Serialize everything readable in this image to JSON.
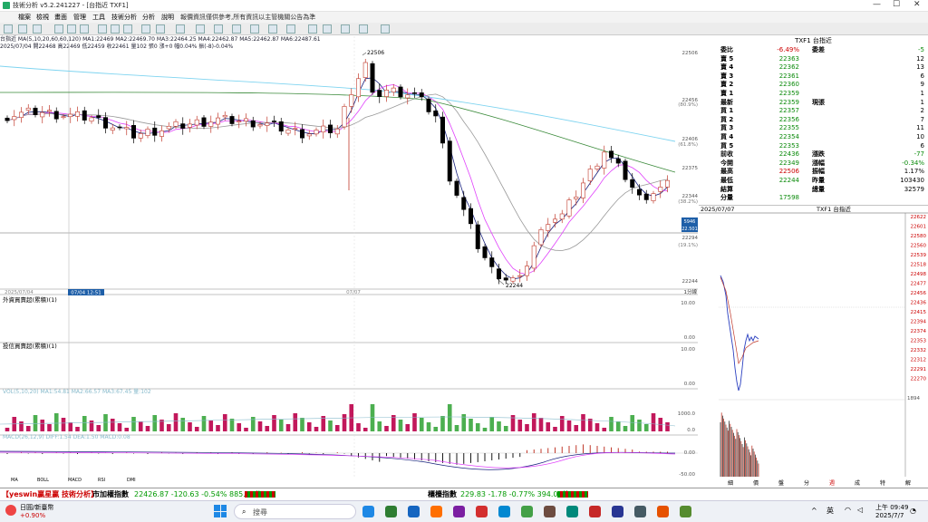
{
  "window": {
    "title": "技術分析 v5.2.241227 - [台指近 TXF1]"
  },
  "menu": [
    "檔案",
    "檢視",
    "畫面",
    "管理",
    "工具",
    "技術分析",
    "分析",
    "說明",
    "報價資訊僅供參考,所有資訊以主管機關公告為準"
  ],
  "info": {
    "line1": "台指近 MA(5,10,20,60,60,120) MA1:22469 MA2:22469.70 MA3:22464.25 MA4:22462.87 MA5:22462.87 MA6:22487.61",
    "line2": "2025/07/04 開22468 高22469 低22459 收22461 量102 張0 漲+0 幅0.04% 振(-8)-0.04%"
  },
  "price_axis": [
    "22506",
    "22456",
    "22406",
    "22375",
    "22359",
    "22344",
    "22294",
    "22244"
  ],
  "axis_pct": [
    "(80.9%)",
    "(61.8%)",
    "(38.2%)",
    "(19.1%)"
  ],
  "annotations": {
    "high": "22506",
    "low": "22244",
    "cursor_date": "07/04 12:51",
    "date2": "07/07",
    "date0": "2025/07/04",
    "vol_box": "5946",
    "price_box": "22.501"
  },
  "panels": {
    "foreign": "外資買賣超(累積)(1)",
    "dealer": "投信買賣超(累積)(1)",
    "vol": "VOL(5,10,20) MA1:54.81 MA2:66.57 MA3:67.45 量:102",
    "macd": "MACD(26,12,9) DIFF:1.54 DEA:1.50 MACD:0.08",
    "period": "1分線"
  },
  "panel_axis": {
    "foreign": [
      "10.00",
      "0.00"
    ],
    "dealer": [
      "10.00",
      "0.00"
    ],
    "vol": [
      "1000.0",
      "0.0"
    ],
    "macd": [
      "0.00",
      "-50.00"
    ]
  },
  "bottom_tabs": [
    "MA",
    "BOLL",
    "MACD",
    "RSI",
    "DMI"
  ],
  "quote": {
    "title": "TXF1 台指近",
    "rows": [
      {
        "l": "委比",
        "v": "-6.49%",
        "r": "委差",
        "rv": "-5"
      },
      {
        "l": "賣 5",
        "v": "22363",
        "r": "",
        "rv": "12"
      },
      {
        "l": "賣 4",
        "v": "22362",
        "r": "",
        "rv": "13"
      },
      {
        "l": "賣 3",
        "v": "22361",
        "r": "",
        "rv": "6"
      },
      {
        "l": "賣 2",
        "v": "22360",
        "r": "",
        "rv": "9"
      },
      {
        "l": "賣 1",
        "v": "22359",
        "r": "",
        "rv": "1"
      },
      {
        "l": "最新",
        "v": "22359",
        "r": "現張",
        "rv": "1"
      },
      {
        "l": "買 1",
        "v": "22357",
        "r": "",
        "rv": "2"
      },
      {
        "l": "買 2",
        "v": "22356",
        "r": "",
        "rv": "7"
      },
      {
        "l": "買 3",
        "v": "22355",
        "r": "",
        "rv": "11"
      },
      {
        "l": "買 4",
        "v": "22354",
        "r": "",
        "rv": "10"
      },
      {
        "l": "買 5",
        "v": "22353",
        "r": "",
        "rv": "6"
      },
      {
        "l": "前收",
        "v": "22436",
        "r": "漲跌",
        "rv": "-77"
      },
      {
        "l": "今開",
        "v": "22349",
        "r": "漲幅",
        "rv": "-0.34%"
      },
      {
        "l": "最高",
        "v": "22506",
        "r": "振幅",
        "rv": "1.17%"
      },
      {
        "l": "最低",
        "v": "22244",
        "r": "昨量",
        "rv": "103430"
      },
      {
        "l": "結算",
        "v": "",
        "r": "總量",
        "rv": "32579"
      },
      {
        "l": "分量",
        "v": "17598",
        "r": "",
        "rv": ""
      }
    ],
    "mini_title_date": "2025/07/07",
    "mini_title": "TXF1 台指近"
  },
  "mini_axis": [
    "22622",
    "22601",
    "22580",
    "22560",
    "22539",
    "22518",
    "22498",
    "22477",
    "22456",
    "22436",
    "22415",
    "22394",
    "22374",
    "22353",
    "22332",
    "22312",
    "22291",
    "22270"
  ],
  "mini_vol": "1894",
  "quote_tabs": [
    "細",
    "價",
    "盤",
    "分",
    "週",
    "成",
    "特",
    "解"
  ],
  "ticker": {
    "left": "【yeswin贏星贏 技術分析】",
    "idx_name": "市加權指數",
    "idx": "22426.87 -120.63 -0.54% 885.59億",
    "idx2_name": "櫃檯指數",
    "idx2": "229.83 -1.78 -0.77% 394.03億"
  },
  "taskbar": {
    "weather": "日圓/新臺幣",
    "weather_chg": "+0.90%",
    "search": "搜尋",
    "lang": "英",
    "time": "上午 09:49",
    "date": "2025/7/7"
  }
}
